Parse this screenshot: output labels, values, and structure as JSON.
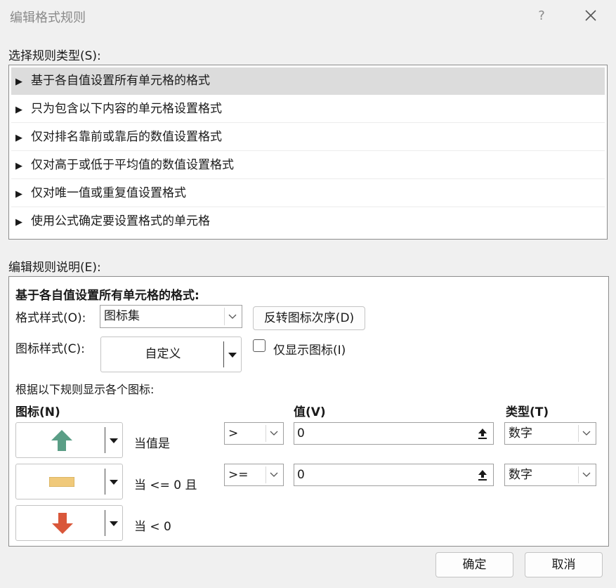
{
  "dialog": {
    "title": "编辑格式规则",
    "help": "?",
    "close_icon": "close-icon"
  },
  "rule_type": {
    "label": "选择规则类型(S):",
    "items": [
      "基于各自值设置所有单元格的格式",
      "只为包含以下内容的单元格设置格式",
      "仅对排名靠前或靠后的数值设置格式",
      "仅对高于或低于平均值的数值设置格式",
      "仅对唯一值或重复值设置格式",
      "使用公式确定要设置格式的单元格"
    ],
    "selected_index": 0,
    "arrow": "▶"
  },
  "rule_desc": {
    "label": "编辑规则说明(E):",
    "heading": "基于各自值设置所有单元格的格式:",
    "format_style_label": "格式样式(O):",
    "format_style_value": "图标集",
    "reverse_button": "反转图标次序(D)",
    "icon_style_label": "图标样式(C):",
    "icon_style_value": "自定义",
    "show_icon_only_label": "仅显示图标(I)",
    "show_icon_only_checked": false,
    "rules_intro": "根据以下规则显示各个图标:",
    "col_icon": "图标(N)",
    "col_value": "值(V)",
    "col_type": "类型(T)",
    "rows": [
      {
        "icon": "green-up-arrow-icon",
        "condition": "当值是",
        "operator": ">",
        "value": "0",
        "type": "数字"
      },
      {
        "icon": "yellow-bar-icon",
        "condition": "当 <= 0 且",
        "operator": ">=",
        "value": "0",
        "type": "数字"
      },
      {
        "icon": "red-down-arrow-icon",
        "condition": "当 < 0"
      }
    ]
  },
  "footer": {
    "ok": "确定",
    "cancel": "取消"
  },
  "colors": {
    "green_arrow": "#5a9e86",
    "yellow_bar": "#f0c97a",
    "red_arrow": "#d9573a",
    "selection": "#dcdcdc"
  }
}
